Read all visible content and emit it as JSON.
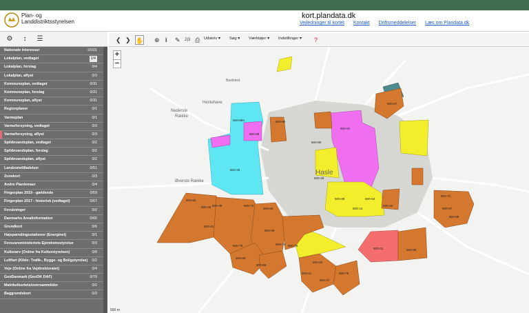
{
  "header": {
    "org_line1": "Plan- og",
    "org_line2": "Landdistriktsstyrelsen",
    "site_title": "kort.plandata.dk",
    "links": [
      "Vejledninger til kortet",
      "Kontakt",
      "Driftsmeddelelser",
      "Læs om Plandata.dk"
    ]
  },
  "toolbar": {
    "menus": [
      "Udskriv",
      "Søg",
      "Værktøjer",
      "Indstillinger"
    ],
    "icon_text": "2|3"
  },
  "sidebar": {
    "layers": [
      {
        "label": "Nationale Interesser",
        "count": "0/101"
      },
      {
        "label": "Lokalplan, vedtaget",
        "count": "1/4",
        "selected": true
      },
      {
        "label": "Lokalplan, forslag",
        "count": "0/4"
      },
      {
        "label": "Lokalplan, aflyst",
        "count": "0/3"
      },
      {
        "label": "Kommuneplan, vedtaget",
        "count": "0/31"
      },
      {
        "label": "Kommuneplan, forslag",
        "count": "0/31"
      },
      {
        "label": "Kommuneplan, aflyst",
        "count": "0/31"
      },
      {
        "label": "Regionplaner",
        "count": "0/1"
      },
      {
        "label": "Varmeplan",
        "count": "0/1"
      },
      {
        "label": "Varmeforsyning, vedtaget",
        "count": "0/3"
      },
      {
        "label": "Varmeforsyning, aflyst",
        "count": "0/3",
        "flag": true
      },
      {
        "label": "Spildevandsplan, vedtaget",
        "count": "0/2"
      },
      {
        "label": "Spildevandsplan, forslag",
        "count": "0/2"
      },
      {
        "label": "Spildevandsplan, aflyst",
        "count": "0/2"
      },
      {
        "label": "Landzonetilladelser",
        "count": "0/51"
      },
      {
        "label": "Zonekort",
        "count": "0/3"
      },
      {
        "label": "Andre Planlemaer",
        "count": "0/4"
      },
      {
        "label": "Fingerplan 2019 - gældende",
        "count": "0/59"
      },
      {
        "label": "Fingerplan 2017 - historisk (vedtaget)",
        "count": "0/67"
      },
      {
        "label": "Forskninger",
        "count": "0/2"
      },
      {
        "label": "Danmarks Arealinformation",
        "count": "0/65"
      },
      {
        "label": "Grundkort",
        "count": "0/6"
      },
      {
        "label": "Højspændingsstationer (Energinet)",
        "count": "0/1"
      },
      {
        "label": "Forsvarsministeriets Ejendomsstyrelse",
        "count": "0/3"
      },
      {
        "label": "Kulturarv (Online fra Kulturstyrelsen)",
        "count": "0/9"
      },
      {
        "label": "Luftfart (Kilde: Trafik-, Bygge- og Boligstyrelse)",
        "count": "0/2"
      },
      {
        "label": "Veje (Online fra Vejdirektoratet)",
        "count": "0/4"
      },
      {
        "label": "GeoDanmark (GeoDK DAF)",
        "count": "0/79"
      },
      {
        "label": "Matrikelkortets/oversammilder",
        "count": "0/2"
      },
      {
        "label": "Baggrundskort",
        "count": "0/3"
      }
    ]
  },
  "map": {
    "places": [
      "Badsted",
      "Nederste",
      "Række",
      "Hestehave",
      "Øverste Række",
      "Hasle"
    ],
    "scale": "500 m",
    "colors": {
      "orange": "#d4772f",
      "cyan": "#5fe6f3",
      "magenta": "#f06ef0",
      "yellow": "#f2ee2c",
      "red": "#f56e6e",
      "teal": "#4f8a8c",
      "town": "#d6d6d2"
    },
    "labels": [
      "500-58A",
      "500-99",
      "500-25",
      "500-62",
      "500-25",
      "500-39",
      "500-72",
      "500-65",
      "500-61",
      "500-80",
      "500-81",
      "500-89",
      "500-12",
      "500-53",
      "500-28",
      "500-42",
      "500-71",
      "500-57",
      "500-58",
      "500-76",
      "500-96",
      "500-74",
      "500-86",
      "500-69",
      "500-79",
      "500-61",
      "500-82",
      "500-47",
      "500-75",
      "500-01",
      "500-98",
      "500-67",
      "500-60"
    ]
  }
}
